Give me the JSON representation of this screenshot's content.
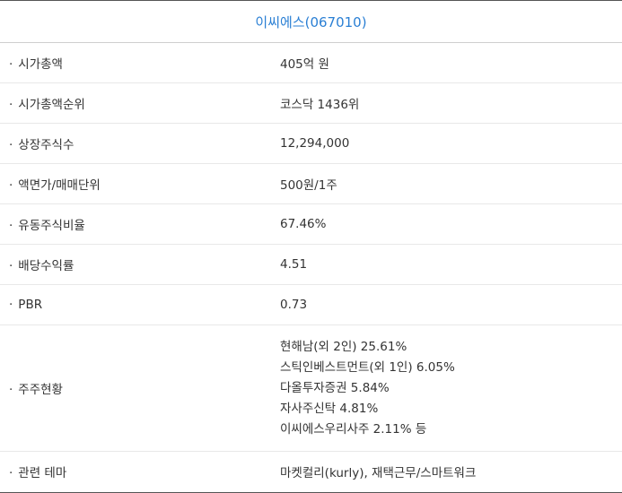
{
  "header": {
    "title": "이씨에스(067010)",
    "link_color": "#2a7fd4"
  },
  "rows": [
    {
      "label": "시가총액",
      "value": "405억 원"
    },
    {
      "label": "시가총액순위",
      "value": "코스닥 1436위"
    },
    {
      "label": "상장주식수",
      "value": "12,294,000"
    },
    {
      "label": "액면가/매매단위",
      "value": "500원/1주"
    },
    {
      "label": "유동주식비율",
      "value": "67.46%"
    },
    {
      "label": "배당수익률",
      "value": "4.51"
    },
    {
      "label": "PBR",
      "value": "0.73"
    }
  ],
  "holders": {
    "label": "주주현황",
    "lines": [
      "현해남(외 2인) 25.61%",
      "스틱인베스트먼트(외 1인) 6.05%",
      "다올투자증권 5.84%",
      "자사주신탁 4.81%",
      "이씨에스우리사주 2.11% 등"
    ]
  },
  "theme": {
    "label": "관련 테마",
    "value": "마켓컬리(kurly), 재택근무/스마트워크"
  },
  "bullet": "·"
}
